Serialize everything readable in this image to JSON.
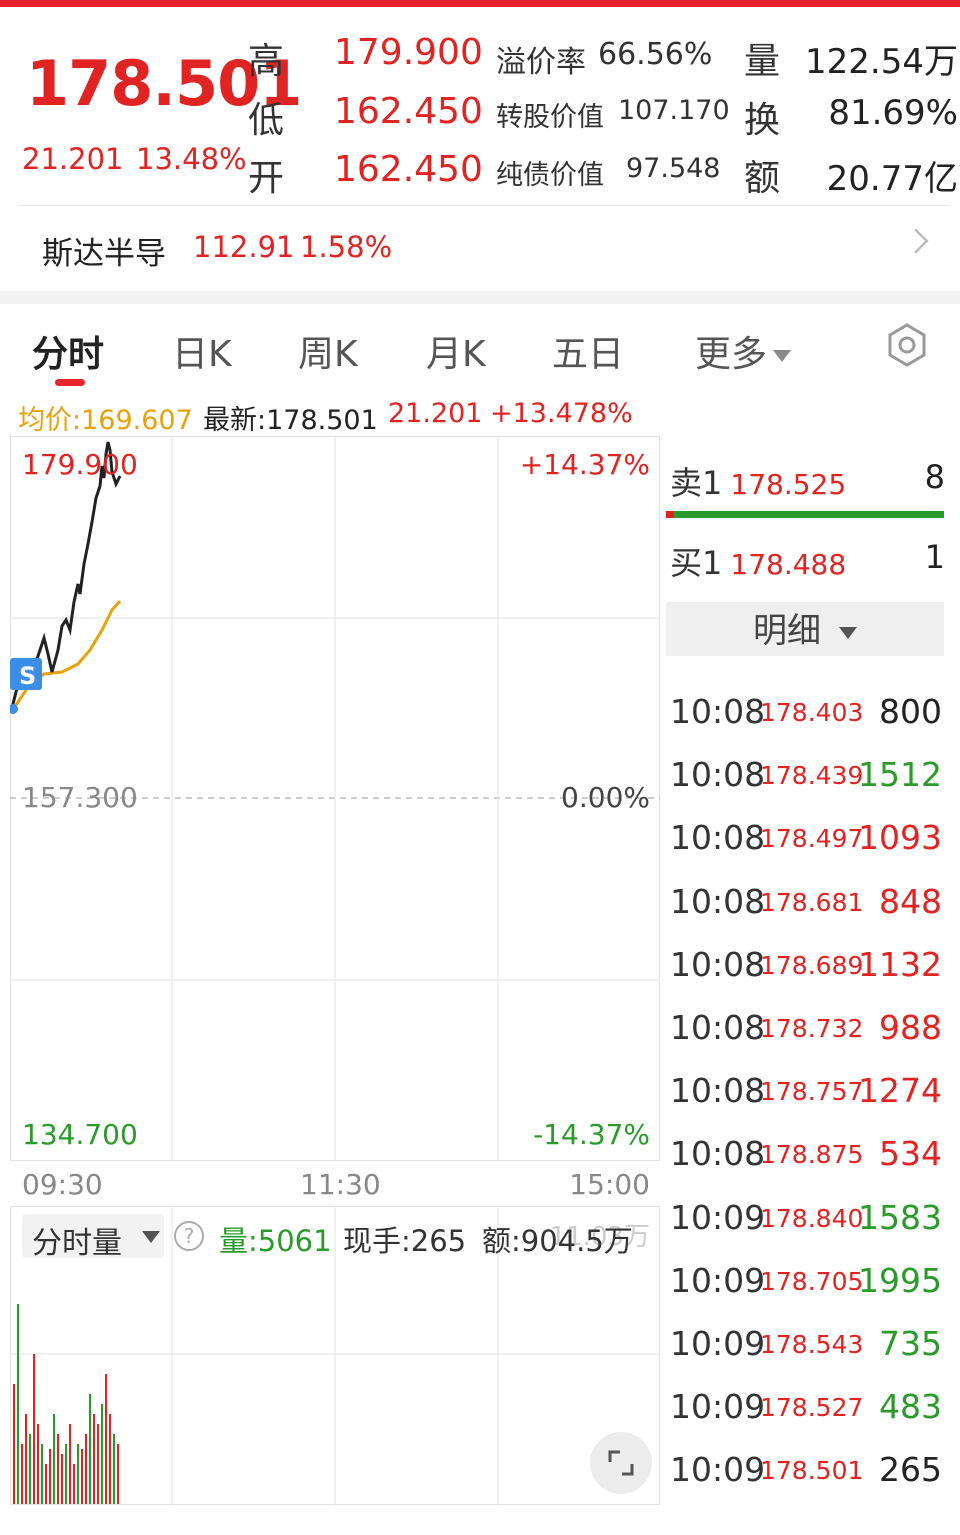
{
  "quote": {
    "price": "178.501",
    "change": "21.201",
    "change_pct": "13.48%",
    "high_label": "高",
    "high": "179.900",
    "low_label": "低",
    "low": "162.450",
    "open_label": "开",
    "open": "162.450",
    "premium_label": "溢价率",
    "premium": "66.56%",
    "conv_label": "转股价值",
    "conv": "107.170",
    "bond_label": "纯债价值",
    "bond": "97.548",
    "vol_label": "量",
    "vol": "122.54万",
    "turn_label": "换",
    "turn": "81.69%",
    "amt_label": "额",
    "amt": "20.77亿"
  },
  "underlying": {
    "name": "斯达半导",
    "price": "112.91",
    "pct": "1.58%"
  },
  "tabs": [
    "分时",
    "日K",
    "周K",
    "月K",
    "五日",
    "更多"
  ],
  "info_bar": {
    "avg": "均价:169.607",
    "latest": "最新:178.501",
    "chg": "21.201",
    "pct": "+13.478%"
  },
  "chart": {
    "y_high": "179.900",
    "y_mid": "157.300",
    "y_low": "134.700",
    "pct_high": "+14.37%",
    "pct_mid": "0.00%",
    "pct_low": "-14.37%",
    "x_labels": [
      "09:30",
      "11:30",
      "15:00"
    ],
    "marker": "S",
    "colors": {
      "price_line": "#222222",
      "avg_line": "#e8a20c",
      "up": "#e02424",
      "down": "#2a9b2a"
    }
  },
  "volume": {
    "selector": "分时量",
    "help": "?",
    "vol": "量:5061",
    "hand": "现手:265",
    "amount": "额:904.5万",
    "scale": "11.03万"
  },
  "order_book": {
    "sell_label": "卖1",
    "sell_price": "178.525",
    "sell_qty": "8",
    "buy_label": "买1",
    "buy_price": "178.488",
    "buy_qty": "1",
    "detail_label": "明细"
  },
  "ticks": [
    {
      "time": "10:08",
      "price": "178.403",
      "qty": "800",
      "dir": "nt"
    },
    {
      "time": "10:08",
      "price": "178.439",
      "qty": "1512",
      "dir": "dn"
    },
    {
      "time": "10:08",
      "price": "178.497",
      "qty": "1093",
      "dir": "up"
    },
    {
      "time": "10:08",
      "price": "178.681",
      "qty": "848",
      "dir": "up"
    },
    {
      "time": "10:08",
      "price": "178.689",
      "qty": "1132",
      "dir": "up"
    },
    {
      "time": "10:08",
      "price": "178.732",
      "qty": "988",
      "dir": "up"
    },
    {
      "time": "10:08",
      "price": "178.757",
      "qty": "1274",
      "dir": "up"
    },
    {
      "time": "10:08",
      "price": "178.875",
      "qty": "534",
      "dir": "up"
    },
    {
      "time": "10:09",
      "price": "178.840",
      "qty": "1583",
      "dir": "dn"
    },
    {
      "time": "10:09",
      "price": "178.705",
      "qty": "1995",
      "dir": "dn"
    },
    {
      "time": "10:09",
      "price": "178.543",
      "qty": "735",
      "dir": "dn"
    },
    {
      "time": "10:09",
      "price": "178.527",
      "qty": "483",
      "dir": "dn"
    },
    {
      "time": "10:09",
      "price": "178.501",
      "qty": "265",
      "dir": "nt"
    }
  ]
}
